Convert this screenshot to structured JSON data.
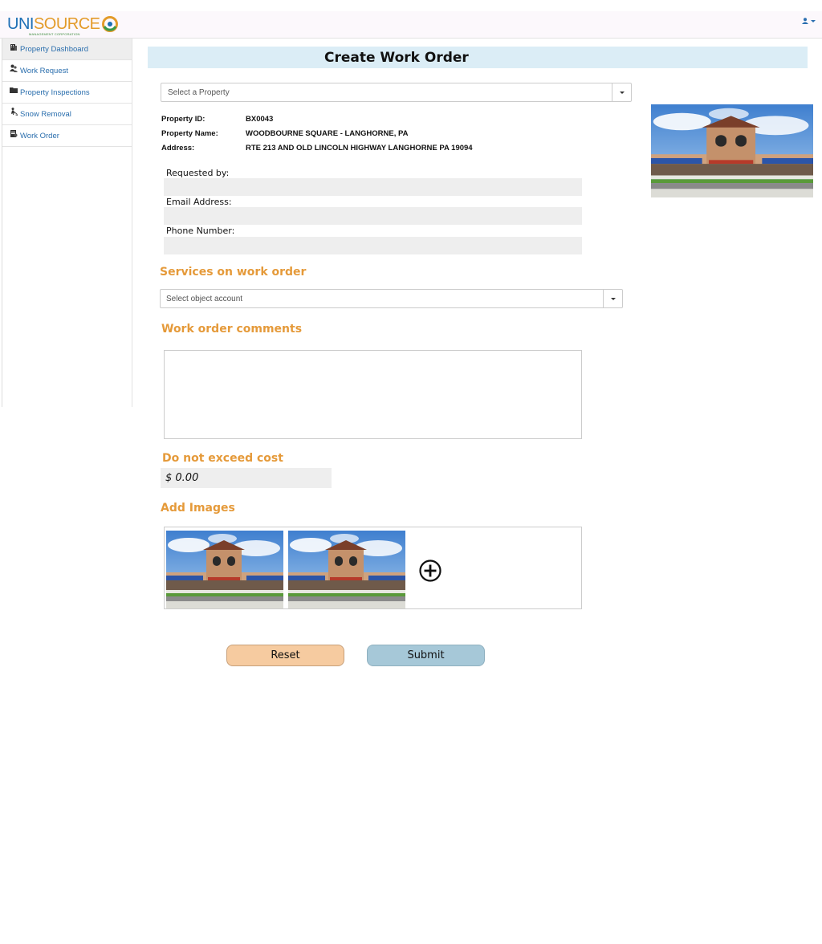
{
  "header": {
    "logo_uni": "UNI",
    "logo_source": "SOURCE",
    "logo_subtitle": "MANAGEMENT CORPORATION",
    "user_icon": "user-icon",
    "colors": {
      "brand_blue": "#1d6fb5",
      "brand_orange": "#e39b2a"
    }
  },
  "sidebar": {
    "items": [
      {
        "label": "Property Dashboard",
        "icon": "building-icon"
      },
      {
        "label": "Work Request",
        "icon": "users-icon"
      },
      {
        "label": "Property Inspections",
        "icon": "folder-icon"
      },
      {
        "label": "Snow Removal",
        "icon": "person-shovel-icon"
      },
      {
        "label": "Work Order",
        "icon": "clipboard-icon"
      }
    ]
  },
  "page": {
    "title": "Create Work Order",
    "property_select_placeholder": "Select a Property"
  },
  "property": {
    "id_label": "Property ID:",
    "id_value": "BX0043",
    "name_label": "Property Name:",
    "name_value": "WOODBOURNE SQUARE - LANGHORNE, PA",
    "address_label": "Address:",
    "address_value": "RTE 213 AND OLD LINCOLN HIGHWAY LANGHORNE PA 19094"
  },
  "contact": {
    "requested_by_label": "Requested by:",
    "requested_by_value": "",
    "email_label": "Email Address:",
    "email_value": "",
    "phone_label": "Phone Number:",
    "phone_value": ""
  },
  "services": {
    "title": "Services on work order",
    "select_placeholder": "Select object account"
  },
  "comments": {
    "title": "Work order comments",
    "value": ""
  },
  "cost": {
    "title": "Do not exceed cost",
    "value": "$ 0.00"
  },
  "images": {
    "title": "Add Images",
    "count": 2,
    "add_icon": "plus-circle-icon"
  },
  "actions": {
    "reset_label": "Reset",
    "submit_label": "Submit"
  },
  "colors": {
    "section_title": "#e59a3a",
    "header_band": "#dbedf6",
    "reset_bg": "#f6cba0",
    "submit_bg": "#a6c8d8"
  }
}
